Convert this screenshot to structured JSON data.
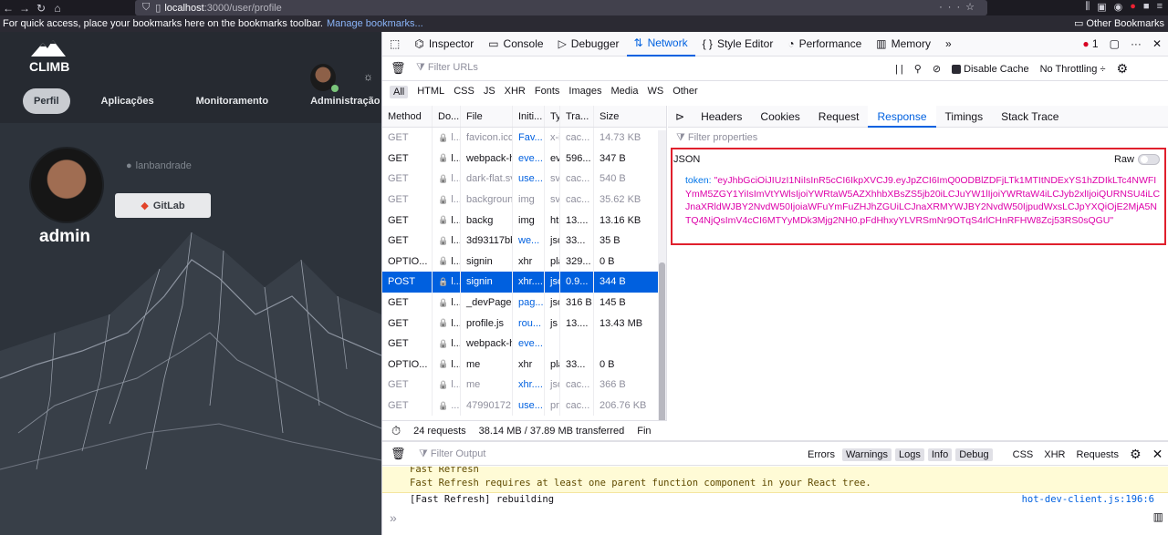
{
  "browser": {
    "url_host": "localhost",
    "url_path": ":3000/user/profile",
    "bookmarks_msg": "For quick access, place your bookmarks here on the bookmarks toolbar.",
    "manage_bookmarks": "Manage bookmarks...",
    "other_bookmarks": "Other Bookmarks"
  },
  "app": {
    "logo_text": "CLIMB",
    "nav": [
      "Perfil",
      "Aplicações",
      "Monitoramento",
      "Administração"
    ],
    "github_user": "lanbandrade",
    "gitlab_button": "GitLab",
    "username": "admin"
  },
  "devtools": {
    "tabs": [
      "Inspector",
      "Console",
      "Debugger",
      "Network",
      "Style Editor",
      "Performance",
      "Memory"
    ],
    "error_count": "1",
    "filter_urls_placeholder": "Filter URLs",
    "pause_label": "| |",
    "disable_cache": "Disable Cache",
    "throttling": "No Throttling ÷",
    "type_filters": [
      "All",
      "HTML",
      "CSS",
      "JS",
      "XHR",
      "Fonts",
      "Images",
      "Media",
      "WS",
      "Other"
    ],
    "columns": [
      "Method",
      "Do...",
      "File",
      "Initi...",
      "Ty",
      "Tra...",
      "Size"
    ],
    "requests": [
      {
        "method": "GET",
        "domain": "l...",
        "file": "favicon.ico",
        "initiator": "Fav...",
        "type": "x-i",
        "transferred": "cac...",
        "size": "14.73 KB",
        "dim": true
      },
      {
        "method": "GET",
        "domain": "l...",
        "file": "webpack-h",
        "initiator": "eve...",
        "type": "ev",
        "transferred": "596...",
        "size": "347 B",
        "dim": false
      },
      {
        "method": "GET",
        "domain": "l...",
        "file": "dark-flat.sv",
        "initiator": "use...",
        "type": "sv",
        "transferred": "cac...",
        "size": "540 B",
        "dim": true
      },
      {
        "method": "GET",
        "domain": "l...",
        "file": "backgroun",
        "initiator": "img",
        "type": "sv",
        "transferred": "cac...",
        "size": "35.62 KB",
        "dim": true
      },
      {
        "method": "GET",
        "domain": "l...",
        "file": "backg",
        "initiator": "img",
        "type": "htr",
        "transferred": "13....",
        "size": "13.16 KB",
        "dim": false
      },
      {
        "method": "GET",
        "domain": "l...",
        "file": "3d93117bb",
        "initiator": "we...",
        "type": "jso",
        "transferred": "33...",
        "size": "35 B",
        "dim": false
      },
      {
        "method": "OPTIO...",
        "domain": "l...",
        "file": "signin",
        "initiator": "xhr",
        "type": "pla",
        "transferred": "329...",
        "size": "0 B",
        "dim": false
      },
      {
        "method": "POST",
        "domain": "l...",
        "file": "signin",
        "initiator": "xhr....",
        "type": "jso",
        "transferred": "0.9...",
        "size": "344 B",
        "dim": false,
        "selected": true
      },
      {
        "method": "GET",
        "domain": "l...",
        "file": "_devPages",
        "initiator": "pag...",
        "type": "jso",
        "transferred": "316 B",
        "size": "145 B",
        "dim": false
      },
      {
        "method": "GET",
        "domain": "l...",
        "file": "profile.js",
        "initiator": "rou...",
        "type": "js",
        "transferred": "13....",
        "size": "13.43 MB",
        "dim": false
      },
      {
        "method": "GET",
        "domain": "l...",
        "file": "webpack-h",
        "initiator": "eve...",
        "type": "",
        "transferred": "",
        "size": "",
        "dim": false
      },
      {
        "method": "OPTIO...",
        "domain": "l...",
        "file": "me",
        "initiator": "xhr",
        "type": "pla",
        "transferred": "33...",
        "size": "0 B",
        "dim": false
      },
      {
        "method": "GET",
        "domain": "l...",
        "file": "me",
        "initiator": "xhr....",
        "type": "jso",
        "transferred": "cac...",
        "size": "366 B",
        "dim": true
      },
      {
        "method": "GET",
        "domain": "...",
        "file": "47990172",
        "initiator": "use...",
        "type": "pn",
        "transferred": "cac...",
        "size": "206.76 KB",
        "dim": true
      }
    ],
    "summary_requests": "24 requests",
    "summary_transfer": "38.14 MB / 37.89 MB transferred",
    "summary_fin": "Fin",
    "response_tabs": [
      "Headers",
      "Cookies",
      "Request",
      "Response",
      "Timings",
      "Stack Trace"
    ],
    "filter_properties_placeholder": "Filter properties",
    "json_label": "JSON",
    "raw_label": "Raw",
    "token_key": "token:",
    "token_value": "\"eyJhbGciOiJIUzI1NiIsInR5cCI6IkpXVCJ9.eyJpZCI6ImQ0ODBlZDFjLTk1MTItNDExYS1hZDIkLTc4NWFIYmM5ZGY1YiIsImVtYWlsIjoiYWRtaW5AZXhhbXBsZS5jb20iLCJuYW1lIjoiYWRtaW4iLCJyb2xlIjoiQURNSU4iLCJnaXRldWJBY2NvdW50IjoiaWFuYmFuZHJhZGUiLCJnaXRMYWJBY2NvdW50IjpudWxsLCJpYXQiOjE2MjA5NTQ4NjQsImV4cCI6MTYyMDk3Mjg2NH0.pFdHhxyYLVRSmNr9OTqS4rlCHnRFHW8Zcj53RS0sQGU\"",
    "console": {
      "filter_placeholder": "Filter Output",
      "levels": [
        "Errors",
        "Warnings",
        "Logs",
        "Info",
        "Debug"
      ],
      "sources": [
        "CSS",
        "XHR",
        "Requests"
      ],
      "warn_line1": "Fast Refresh",
      "warn_line2": "Fast Refresh requires at least one parent function component in your React tree.",
      "msg_line": "[Fast Refresh] rebuilding",
      "msg_source": "hot-dev-client.js:196:6"
    }
  }
}
